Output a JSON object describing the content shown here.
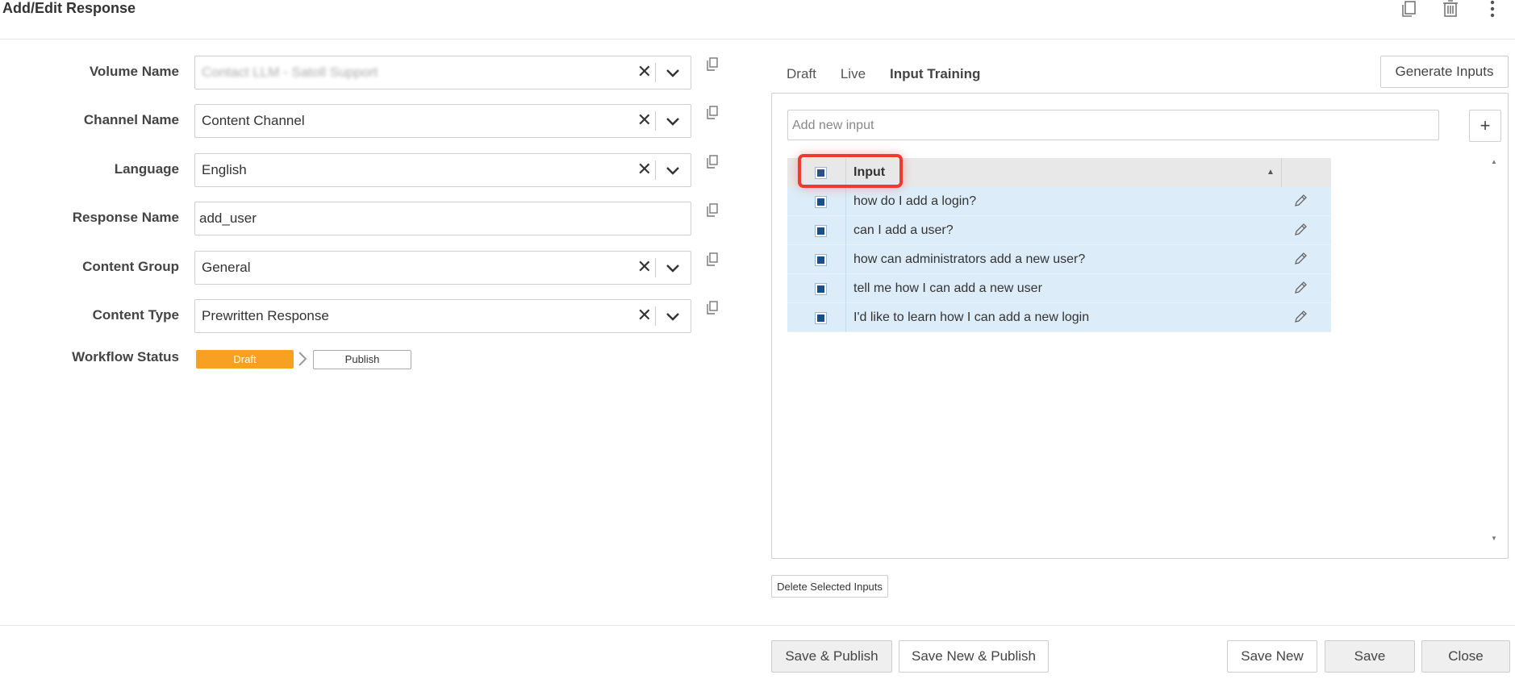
{
  "window": {
    "title": "Add/Edit Response"
  },
  "header_icons": [
    "copy-icon",
    "trash-icon",
    "more-vertical-icon"
  ],
  "form": {
    "volume_name": {
      "label": "Volume Name",
      "value": "Contact LLM - Satoll Support"
    },
    "channel_name": {
      "label": "Channel Name",
      "value": "Content Channel"
    },
    "language": {
      "label": "Language",
      "value": "English"
    },
    "response_name": {
      "label": "Response Name",
      "value": "add_user"
    },
    "content_group": {
      "label": "Content Group",
      "value": "General"
    },
    "content_type": {
      "label": "Content Type",
      "value": "Prewritten Response"
    },
    "workflow_status": {
      "label": "Workflow Status",
      "draft": "Draft",
      "publish": "Publish"
    }
  },
  "tabs": [
    {
      "label": "Draft",
      "active": false
    },
    {
      "label": "Live",
      "active": false
    },
    {
      "label": "Input Training",
      "active": true
    }
  ],
  "buttons": {
    "generate_inputs": "Generate Inputs",
    "plus": "+",
    "delete_selected": "Delete Selected Inputs",
    "save_publish": "Save & Publish",
    "save_new_publish": "Save New & Publish",
    "save_new": "Save New",
    "save": "Save",
    "close": "Close"
  },
  "add_input": {
    "placeholder": "Add new input"
  },
  "grid": {
    "column_header": "Input",
    "rows": [
      "how do I add a login?",
      "can I add a user?",
      "how can administrators add a new user?",
      "tell me how I can add a new user",
      "I'd like to learn how I can add a new login"
    ]
  },
  "colors": {
    "draft_status": "#f7a021",
    "row_selected": "#dcecf8",
    "highlight": "#ee3a30"
  }
}
